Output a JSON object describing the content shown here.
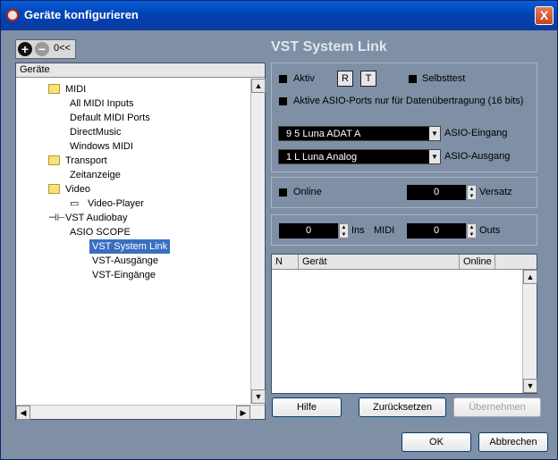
{
  "window": {
    "title": "Geräte konfigurieren",
    "close_label": "X"
  },
  "toolbar": {
    "expand_label": "0<<"
  },
  "tree": {
    "header": "Geräte",
    "nodes": {
      "midi": "MIDI",
      "all_midi_inputs": "All MIDI Inputs",
      "default_midi_ports": "Default MIDI Ports",
      "directmusic": "DirectMusic",
      "windows_midi": "Windows MIDI",
      "transport": "Transport",
      "zeitanzeige": "Zeitanzeige",
      "video": "Video",
      "video_player": "Video-Player",
      "vst_audiobay": "VST Audiobay",
      "asio_scope": "ASIO SCOPE",
      "vst_system_link": "VST System Link",
      "vst_ausgaenge": "VST-Ausgänge",
      "vst_eingaenge": "VST-Eingänge"
    }
  },
  "panel": {
    "title": "VST System Link",
    "aktiv": "Aktiv",
    "r": "R",
    "t": "T",
    "selbsttest": "Selbsttest",
    "aktive_asio": "Aktive ASIO-Ports nur für Datenübertragung (16 bits)",
    "asio_in_value": "9 5 Luna ADAT A",
    "asio_in_label": "ASIO-Eingang",
    "asio_out_value": "1 L Luna Analog",
    "asio_out_label": "ASIO-Ausgang",
    "online": "Online",
    "versatz_value": "0",
    "versatz": "Versatz",
    "ins_value": "0",
    "ins": "Ins",
    "midi": "MIDI",
    "outs_value": "0",
    "outs": "Outs",
    "columns": {
      "n": "N",
      "geraet": "Gerät",
      "online": "Online"
    }
  },
  "buttons": {
    "hilfe": "Hilfe",
    "zuruecksetzen": "Zurücksetzen",
    "uebernehmen": "Übernehmen",
    "ok": "OK",
    "abbrechen": "Abbrechen"
  }
}
